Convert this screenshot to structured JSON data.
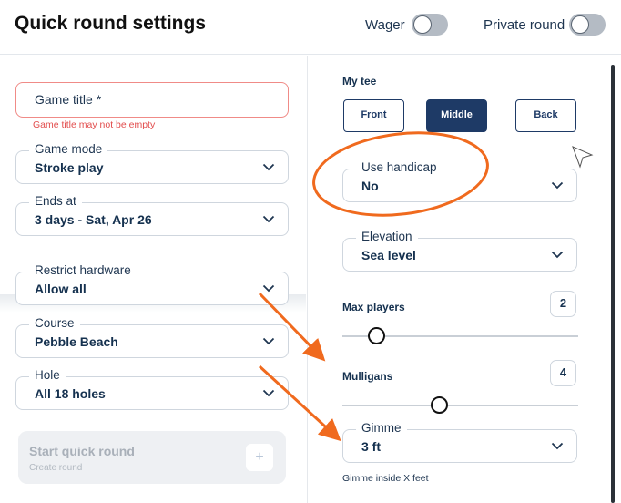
{
  "header": {
    "title": "Quick round settings",
    "wager_label": "Wager",
    "private_label": "Private round"
  },
  "left": {
    "game_title": {
      "placeholder": "Game title *",
      "error": "Game title may not be empty"
    },
    "game_mode": {
      "label": "Game mode",
      "value": "Stroke play"
    },
    "ends_at": {
      "label": "Ends at",
      "value": "3 days - Sat, Apr 26"
    },
    "restrict_hardware": {
      "label": "Restrict hardware",
      "value": "Allow all"
    },
    "course": {
      "label": "Course",
      "value": "Pebble Beach"
    },
    "hole": {
      "label": "Hole",
      "value": "All 18 holes"
    },
    "start": {
      "label": "Start quick round",
      "sub": "Create round",
      "plus": "+"
    }
  },
  "right": {
    "my_tee": {
      "label": "My tee",
      "options": [
        "Front",
        "Middle",
        "Back"
      ],
      "selected": "Middle"
    },
    "use_handicap": {
      "label": "Use handicap",
      "value": "No"
    },
    "elevation": {
      "label": "Elevation",
      "value": "Sea level"
    },
    "max_players": {
      "label": "Max players",
      "value": "2"
    },
    "mulligans": {
      "label": "Mulligans",
      "value": "4"
    },
    "gimme": {
      "label": "Gimme",
      "value": "3 ft",
      "hint": "Gimme inside X feet"
    }
  },
  "colors": {
    "accent": "#1e3a66",
    "error": "#e24d4d",
    "annotation": "#f06a1e"
  }
}
